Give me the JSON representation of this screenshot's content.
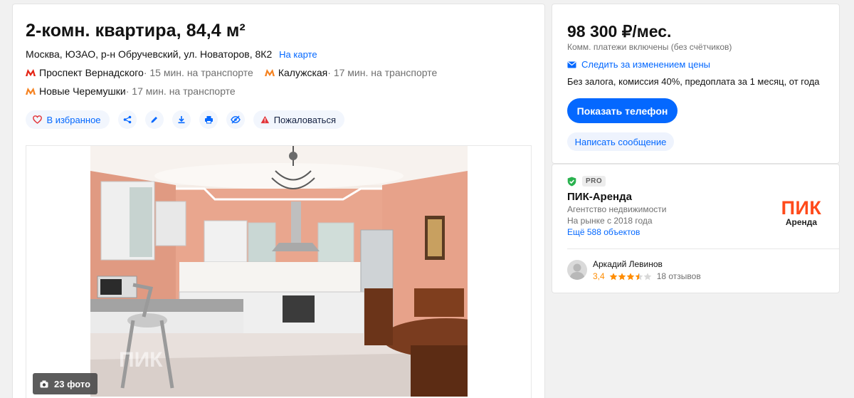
{
  "listing": {
    "title": "2-комн. квартира, 84,4 м²",
    "address": "Москва, ЮЗАО, р-н Обручевский, ул. Новаторов, 8К2",
    "map_link": "На карте",
    "metro": [
      {
        "station": "Проспект Вернадского",
        "distance": " · 15 мин. на транспорте",
        "color": "#e42313"
      },
      {
        "station": "Калужская",
        "distance": " · 17 мин. на транспорте",
        "color": "#f58220"
      },
      {
        "station": "Новые Черемушки",
        "distance": " · 17 мин. на транспорте",
        "color": "#f58220"
      }
    ],
    "actions": {
      "favorite": "В избранное",
      "complain": "Пожаловаться"
    },
    "photo_count": "23 фото",
    "watermark": "ПИК АРЕНДА"
  },
  "price": {
    "amount": "98 300 ₽/мес.",
    "note": "Комм. платежи включены (без счётчиков)",
    "follow": "Следить за изменением цены",
    "terms": "Без залога, комиссия 40%, предоплата за 1 месяц, от года",
    "show_phone": "Показать телефон",
    "write_message": "Написать сообщение"
  },
  "agency": {
    "badge": "PRO",
    "name": "ПИК-Аренда",
    "type": "Агентство недвижимости",
    "since": "На рынке с 2018 года",
    "more": "Ещё 588 объектов",
    "logo_big": "ПИК",
    "logo_small": "Аренда",
    "agent_name": "Аркадий Левинов",
    "rating": "3,4",
    "rating_value": 3.4,
    "reviews": "18 отзывов"
  },
  "colors": {
    "accent": "#0468ff",
    "pik": "#ff4a1a",
    "star": "#ff8c00",
    "verified": "#2ab24f"
  }
}
